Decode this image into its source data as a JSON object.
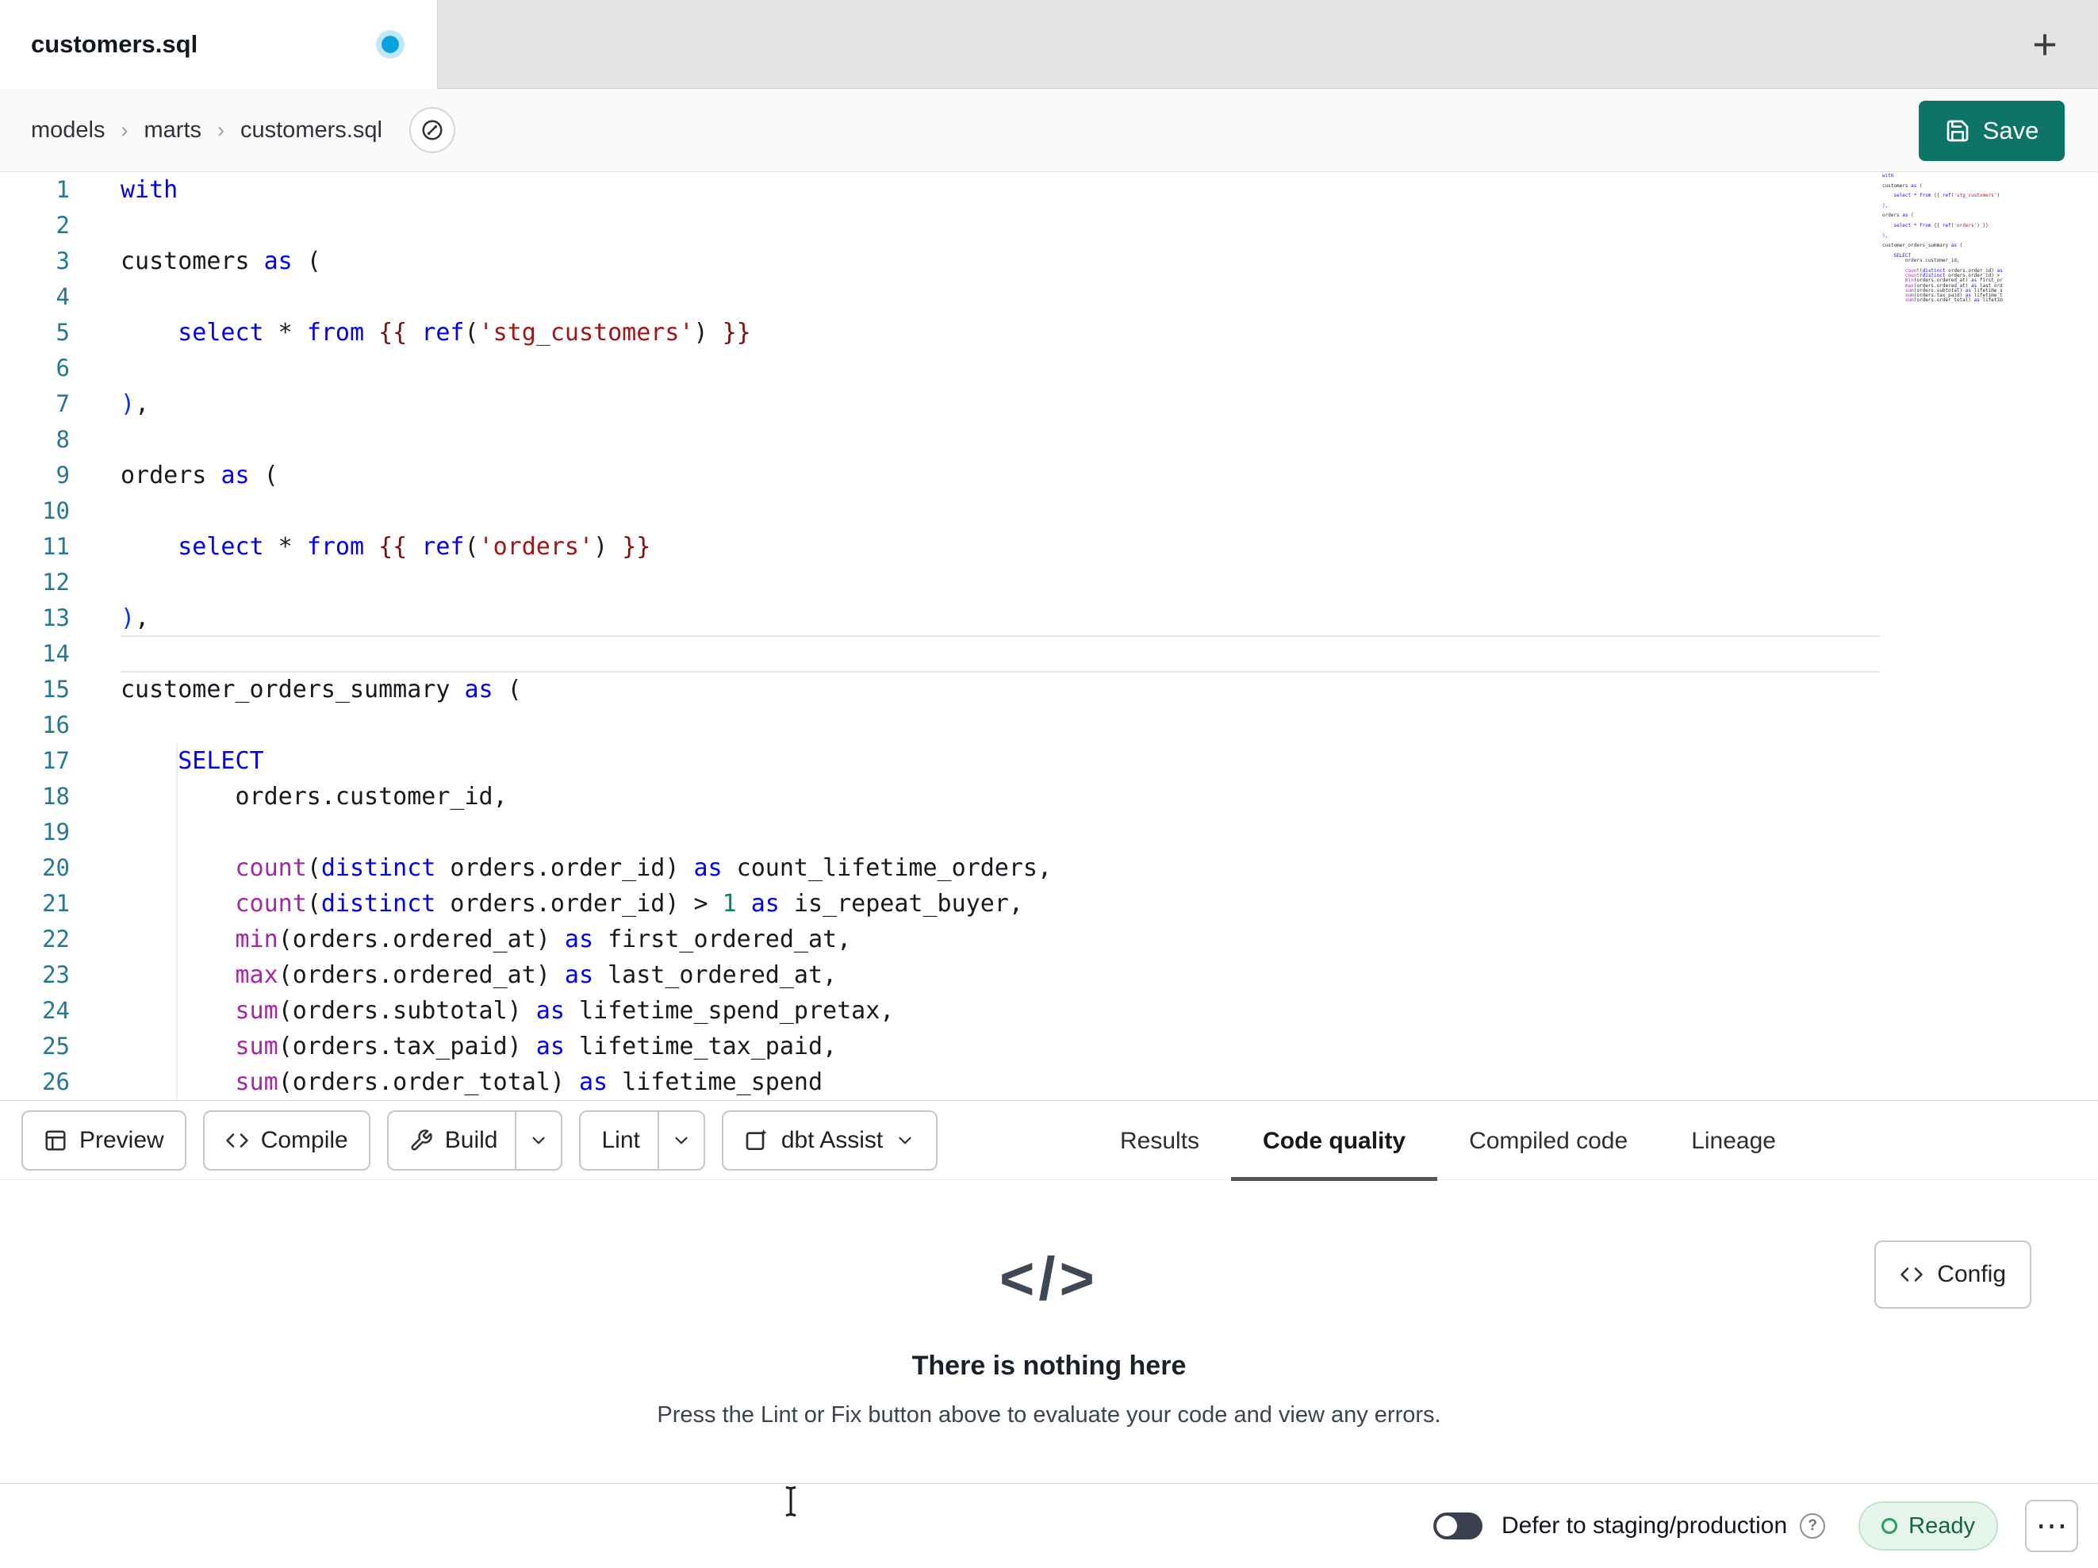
{
  "tab_bar": {
    "active_tab_title": "customers.sql",
    "new_tab_label": "+"
  },
  "breadcrumb": {
    "items": [
      "models",
      "marts",
      "customers.sql"
    ],
    "separator": "›"
  },
  "header": {
    "save_label": "Save"
  },
  "editor": {
    "language": "sql",
    "lines": [
      {
        "n": "1",
        "tokens": [
          [
            "k",
            "with"
          ]
        ]
      },
      {
        "n": "2",
        "tokens": []
      },
      {
        "n": "3",
        "tokens": [
          [
            "p",
            "customers "
          ],
          [
            "k",
            "as"
          ],
          [
            "p",
            " ("
          ]
        ]
      },
      {
        "n": "4",
        "tokens": []
      },
      {
        "n": "5",
        "tokens": [
          [
            "p",
            "    "
          ],
          [
            "k",
            "select"
          ],
          [
            "p",
            " * "
          ],
          [
            "k",
            "from"
          ],
          [
            "p",
            " "
          ],
          [
            "j",
            "{{"
          ],
          [
            "p",
            " "
          ],
          [
            "k",
            "ref"
          ],
          [
            "p",
            "("
          ],
          [
            "s",
            "'stg_customers'"
          ],
          [
            "p",
            ")"
          ],
          [
            "p",
            " "
          ],
          [
            "j",
            "}}"
          ]
        ]
      },
      {
        "n": "6",
        "tokens": []
      },
      {
        "n": "7",
        "tokens": [
          [
            "b",
            ")"
          ],
          [
            "p",
            ","
          ]
        ]
      },
      {
        "n": "8",
        "tokens": []
      },
      {
        "n": "9",
        "tokens": [
          [
            "p",
            "orders "
          ],
          [
            "k",
            "as"
          ],
          [
            "p",
            " ("
          ]
        ]
      },
      {
        "n": "10",
        "tokens": []
      },
      {
        "n": "11",
        "tokens": [
          [
            "p",
            "    "
          ],
          [
            "k",
            "select"
          ],
          [
            "p",
            " * "
          ],
          [
            "k",
            "from"
          ],
          [
            "p",
            " "
          ],
          [
            "j",
            "{{"
          ],
          [
            "p",
            " "
          ],
          [
            "k",
            "ref"
          ],
          [
            "p",
            "("
          ],
          [
            "s",
            "'orders'"
          ],
          [
            "p",
            ")"
          ],
          [
            "p",
            " "
          ],
          [
            "j",
            "}}"
          ]
        ]
      },
      {
        "n": "12",
        "tokens": []
      },
      {
        "n": "13",
        "tokens": [
          [
            "b",
            ")"
          ],
          [
            "p",
            ","
          ]
        ]
      },
      {
        "n": "14",
        "tokens": [],
        "current": true
      },
      {
        "n": "15",
        "tokens": [
          [
            "p",
            "customer_orders_summary "
          ],
          [
            "k",
            "as"
          ],
          [
            "p",
            " ("
          ]
        ]
      },
      {
        "n": "16",
        "tokens": []
      },
      {
        "n": "17",
        "tokens": [
          [
            "p",
            "    "
          ],
          [
            "k",
            "SELECT"
          ]
        ]
      },
      {
        "n": "18",
        "tokens": [
          [
            "p",
            "        orders.customer_id,"
          ]
        ]
      },
      {
        "n": "19",
        "tokens": []
      },
      {
        "n": "20",
        "tokens": [
          [
            "p",
            "        "
          ],
          [
            "f",
            "count"
          ],
          [
            "p",
            "("
          ],
          [
            "k",
            "distinct"
          ],
          [
            "p",
            " orders.order_id) "
          ],
          [
            "k",
            "as"
          ],
          [
            "p",
            " count_lifetime_orders,"
          ]
        ]
      },
      {
        "n": "21",
        "tokens": [
          [
            "p",
            "        "
          ],
          [
            "f",
            "count"
          ],
          [
            "p",
            "("
          ],
          [
            "k",
            "distinct"
          ],
          [
            "p",
            " orders.order_id) > "
          ],
          [
            "n",
            "1"
          ],
          [
            "p",
            " "
          ],
          [
            "k",
            "as"
          ],
          [
            "p",
            " is_repeat_buyer,"
          ]
        ]
      },
      {
        "n": "22",
        "tokens": [
          [
            "p",
            "        "
          ],
          [
            "f",
            "min"
          ],
          [
            "p",
            "(orders.ordered_at) "
          ],
          [
            "k",
            "as"
          ],
          [
            "p",
            " first_ordered_at,"
          ]
        ]
      },
      {
        "n": "23",
        "tokens": [
          [
            "p",
            "        "
          ],
          [
            "f",
            "max"
          ],
          [
            "p",
            "(orders.ordered_at) "
          ],
          [
            "k",
            "as"
          ],
          [
            "p",
            " last_ordered_at,"
          ]
        ]
      },
      {
        "n": "24",
        "tokens": [
          [
            "p",
            "        "
          ],
          [
            "f",
            "sum"
          ],
          [
            "p",
            "(orders.subtotal) "
          ],
          [
            "k",
            "as"
          ],
          [
            "p",
            " lifetime_spend_pretax,"
          ]
        ]
      },
      {
        "n": "25",
        "tokens": [
          [
            "p",
            "        "
          ],
          [
            "f",
            "sum"
          ],
          [
            "p",
            "(orders.tax_paid) "
          ],
          [
            "k",
            "as"
          ],
          [
            "p",
            " lifetime_tax_paid,"
          ]
        ]
      },
      {
        "n": "26",
        "tokens": [
          [
            "p",
            "        "
          ],
          [
            "f",
            "sum"
          ],
          [
            "p",
            "(orders.order_total) "
          ],
          [
            "k",
            "as"
          ],
          [
            "p",
            " lifetime_spend"
          ]
        ]
      }
    ]
  },
  "toolbar": {
    "preview": {
      "label": "Preview"
    },
    "compile": {
      "label": "Compile"
    },
    "build": {
      "label": "Build"
    },
    "lint": {
      "label": "Lint"
    },
    "dbt_assist": {
      "label": "dbt Assist"
    },
    "tabs": [
      {
        "label": "Results",
        "active": false
      },
      {
        "label": "Code quality",
        "active": true
      },
      {
        "label": "Compiled code",
        "active": false
      },
      {
        "label": "Lineage",
        "active": false
      }
    ]
  },
  "results_panel": {
    "config_label": "Config",
    "empty_icon": "</>",
    "title": "There is nothing here",
    "subtitle": "Press the Lint or Fix button above to evaluate your code and view any errors."
  },
  "status_bar": {
    "defer_label": "Defer to staging/production",
    "help_label": "?",
    "ready_label": "Ready",
    "more_label": "⋯"
  },
  "colors": {
    "save_button": "#0d7468",
    "tab_dot": "#0aa3e0",
    "keyword": "#0000ee",
    "string": "#a31515",
    "function": "#a626a4",
    "jinja": "#7a1010",
    "number": "#098658",
    "bracket": "#0431fa",
    "line_number": "#237893",
    "active_underline": "#54585e",
    "ready_bg": "#e6f5ec",
    "ready_text": "#13673b"
  }
}
